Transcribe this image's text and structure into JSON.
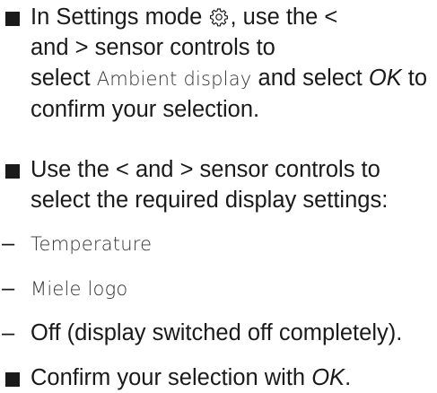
{
  "instructions": {
    "step1": {
      "a": "In Settings mode",
      "b": ", use the <",
      "c": "and > sensor controls to",
      "d": "select",
      "e": "Ambient display",
      "f": "and select",
      "g": "OK",
      "h": "to",
      "i": "confirm your selection.",
      "icon": "gear-icon"
    },
    "step2": {
      "line1": "Use the < and > sensor controls to",
      "line2": "select the required display settings:"
    },
    "options": [
      "Temperature",
      "Miele logo",
      "Off (display switched off completely)."
    ],
    "dash": "–",
    "step3": {
      "a": "Confirm your selection with",
      "b": "OK",
      "c": "."
    }
  }
}
